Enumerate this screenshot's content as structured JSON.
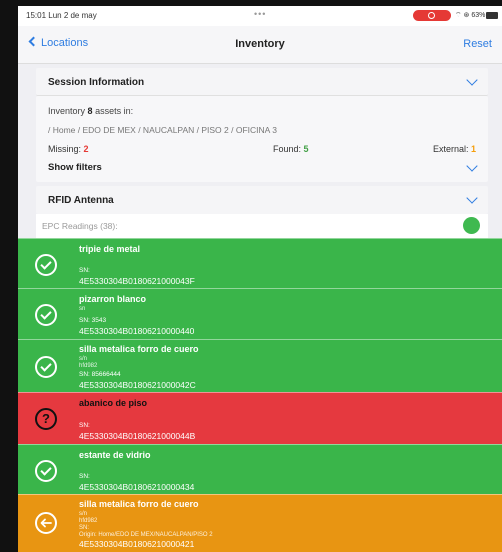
{
  "status": {
    "time": "15:01  Lun 2 de may",
    "dots": "•••",
    "sys": "⌔ ⊛ 63%"
  },
  "nav": {
    "back": "Locations",
    "title": "Inventory",
    "reset": "Reset"
  },
  "session": {
    "title": "Session Information",
    "line_prefix": "Inventory",
    "count": "8",
    "line_suffix": "assets in:",
    "path": "/ Home / EDO DE  MEX / NAUCALPAN / PISO 2 / OFICINA 3",
    "missing_label": "Missing:",
    "missing": "2",
    "found_label": "Found:",
    "found": "5",
    "external_label": "External:",
    "external": "1",
    "filters": "Show filters"
  },
  "rfid": {
    "title": "RFID Antenna",
    "epc": "EPC Readings (38):"
  },
  "colors": {
    "found": "#3ab54a",
    "missing": "#e5393f",
    "external": "#e89512",
    "accent": "#2f7de1"
  },
  "items": [
    {
      "title": "tripie de metal",
      "sn": "SN:",
      "epc": "4E5330304B0180621000043F",
      "status": "found",
      "icon": "check-circle-icon"
    },
    {
      "title": "pizarron blanco",
      "l1": "sn",
      "sn": "SN: 3543",
      "epc": "4E5330304B01806210000440",
      "status": "found",
      "icon": "check-circle-icon"
    },
    {
      "title": "silla metalica forro de cuero",
      "l1": "s/n",
      "l2": "hfd982",
      "sn": "SN: 85666444",
      "epc": "4E5330304B0180621000042C",
      "status": "found",
      "icon": "check-circle-icon"
    },
    {
      "title": "abanico de piso",
      "sn": "SN:",
      "epc": "4E5330304B0180621000044B",
      "status": "missing",
      "icon": "question-circle-icon"
    },
    {
      "title": "estante de vidrio",
      "sn": "SN:",
      "epc": "4E5330304B01806210000434",
      "status": "found",
      "icon": "check-circle-icon"
    },
    {
      "title": "silla metalica forro de cuero",
      "l1": "s/n",
      "l2": "hfd982",
      "l3": "SN:",
      "sn": "Origin: Home/EDO DE  MEX/NAUCALPAN/PISO 2",
      "epc": "4E5330304B01806210000421",
      "status": "external",
      "icon": "arrow-left-circle-icon"
    }
  ]
}
